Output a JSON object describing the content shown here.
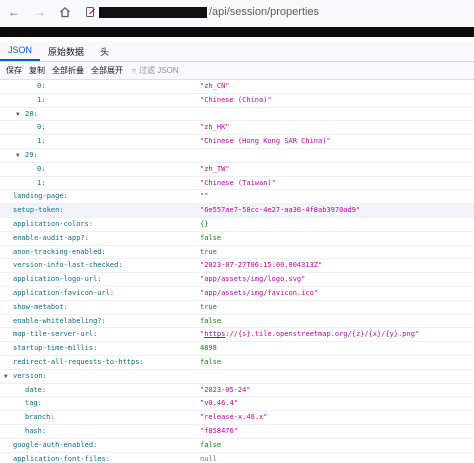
{
  "browser": {
    "url_suffix": "/api/session/properties"
  },
  "viewer": {
    "tabs": [
      "JSON",
      "原始数据",
      "头"
    ],
    "active_tab": "JSON",
    "toolbar": {
      "save": "保存",
      "copy": "复制",
      "collapse_all": "全部折叠",
      "expand_all": "全部展开",
      "filter_placeholder": "过滤 JSON"
    }
  },
  "rows": [
    {
      "key": "0:",
      "indent": 2,
      "type": "string",
      "value": "\"zh_CN\""
    },
    {
      "key": "1:",
      "indent": 2,
      "type": "string",
      "value": "\"Chinese (China)\""
    },
    {
      "key": "28:",
      "indent": 1,
      "expander": true,
      "type": "none",
      "value": ""
    },
    {
      "key": "0:",
      "indent": 2,
      "type": "string",
      "value": "\"zh_HK\""
    },
    {
      "key": "1:",
      "indent": 2,
      "type": "string",
      "value": "\"Chinese (Hong Kong SAR China)\""
    },
    {
      "key": "29:",
      "indent": 1,
      "expander": true,
      "type": "none",
      "value": ""
    },
    {
      "key": "0:",
      "indent": 2,
      "type": "string",
      "value": "\"zh_TW\""
    },
    {
      "key": "1:",
      "indent": 2,
      "type": "string",
      "value": "\"Chinese (Taiwan)\""
    },
    {
      "key": "landing-page:",
      "indent": 0,
      "type": "string",
      "value": "\"\""
    },
    {
      "key": "setup-token:",
      "indent": 0,
      "type": "string",
      "value": "\"6e557ae7-58cc-4e27-aa36-4f8ab3970ad9\"",
      "selected": true
    },
    {
      "key": "application-colors:",
      "indent": 0,
      "type": "bool",
      "value": "{}"
    },
    {
      "key": "enable-audit-app?:",
      "indent": 0,
      "type": "bool",
      "value": "false"
    },
    {
      "key": "anon-tracking-enabled:",
      "indent": 0,
      "type": "bool",
      "value": "true"
    },
    {
      "key": "version-info-last-checked:",
      "indent": 0,
      "type": "string",
      "value": "\"2023-07-27T06:15:00.004313Z\""
    },
    {
      "key": "application-logo-url:",
      "indent": 0,
      "type": "string",
      "value": "\"app/assets/img/logo.svg\""
    },
    {
      "key": "application-favicon-url:",
      "indent": 0,
      "type": "string",
      "value": "\"app/assets/img/favicon.ico\""
    },
    {
      "key": "show-metabot:",
      "indent": 0,
      "type": "bool",
      "value": "true"
    },
    {
      "key": "enable-whitelabeling?:",
      "indent": 0,
      "type": "bool",
      "value": "false"
    },
    {
      "key": "map-tile-server-url:",
      "indent": 0,
      "type": "link",
      "value_prefix": "\"",
      "value_link": "https",
      "value_rest": "://{s}.tile.openstreetmap.org/{z}/{x}/{y}.png\""
    },
    {
      "key": "startup-time-millis:",
      "indent": 0,
      "type": "num",
      "value": "4898"
    },
    {
      "key": "redirect-all-requests-to-https:",
      "indent": 0,
      "type": "bool",
      "value": "false"
    },
    {
      "key": "version:",
      "indent": 0,
      "expander": true,
      "type": "none",
      "value": ""
    },
    {
      "key": "date:",
      "indent": 1,
      "type": "string",
      "value": "\"2023-05-24\""
    },
    {
      "key": "tag:",
      "indent": 1,
      "type": "string",
      "value": "\"v0.46.4\""
    },
    {
      "key": "branch:",
      "indent": 1,
      "type": "string",
      "value": "\"release-x.46.x\""
    },
    {
      "key": "hash:",
      "indent": 1,
      "type": "string",
      "value": "\"f858476\""
    },
    {
      "key": "google-auth-enabled:",
      "indent": 0,
      "type": "bool",
      "value": "false"
    },
    {
      "key": "application-font-files:",
      "indent": 0,
      "type": "null",
      "value": "null"
    }
  ]
}
